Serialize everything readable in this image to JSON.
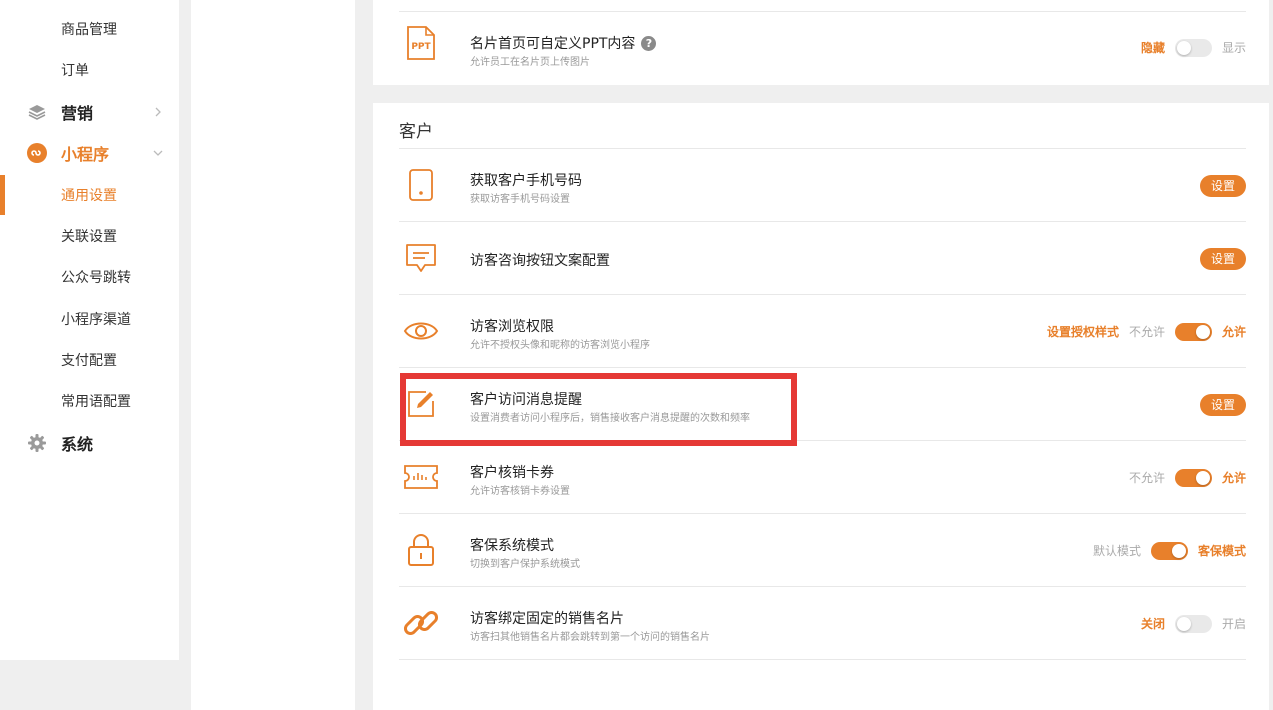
{
  "sidebar": {
    "items": [
      {
        "label": "商品管理",
        "type": "sub"
      },
      {
        "label": "订单",
        "type": "sub"
      },
      {
        "label": "营销",
        "type": "group",
        "icon": "layers-icon"
      },
      {
        "label": "小程序",
        "type": "group",
        "icon": "mini-program-icon",
        "active": true
      },
      {
        "label": "通用设置",
        "type": "sub",
        "active": true
      },
      {
        "label": "关联设置",
        "type": "sub"
      },
      {
        "label": "公众号跳转",
        "type": "sub"
      },
      {
        "label": "小程序渠道",
        "type": "sub"
      },
      {
        "label": "支付配置",
        "type": "sub"
      },
      {
        "label": "常用语配置",
        "type": "sub"
      },
      {
        "label": "系统",
        "type": "group",
        "icon": "gear-icon"
      }
    ]
  },
  "top_row": {
    "title": "名片首页可自定义PPT内容",
    "desc": "允许员工在名片页上传图片",
    "icon_text": "PPT",
    "left_label": "隐藏",
    "right_label": "显示",
    "switch_on": false
  },
  "section": {
    "title": "客户",
    "rows": [
      {
        "title": "获取客户手机号码",
        "desc": "获取访客手机号码设置",
        "icon": "phone-icon",
        "button": "设置"
      },
      {
        "title": "访客咨询按钮文案配置",
        "desc": "",
        "icon": "message-icon",
        "button": "设置"
      },
      {
        "title": "访客浏览权限",
        "desc": "允许不授权头像和昵称的访客浏览小程序",
        "icon": "eye-icon",
        "link": "设置授权样式",
        "left_label": "不允许",
        "right_label": "允许",
        "switch_on": true
      },
      {
        "title": "客户访问消息提醒",
        "desc": "设置消费者访问小程序后，销售接收客户消息提醒的次数和频率",
        "icon": "edit-icon",
        "button": "设置"
      },
      {
        "title": "客户核销卡券",
        "desc": "允许访客核销卡券设置",
        "icon": "ticket-icon",
        "left_label": "不允许",
        "right_label": "允许",
        "switch_on": true
      },
      {
        "title": "客保系统模式",
        "desc": "切换到客户保护系统模式",
        "icon": "lock-icon",
        "left_label": "默认模式",
        "right_label": "客保模式",
        "switch_on": true
      },
      {
        "title": "访客绑定固定的销售名片",
        "desc": "访客扫其他销售名片都会跳转到第一个访问的销售名片",
        "icon": "link-icon",
        "left_label": "关闭",
        "right_label": "开启",
        "switch_on": false
      }
    ]
  },
  "colors": {
    "accent": "#e8802b",
    "highlight": "#e53935"
  }
}
